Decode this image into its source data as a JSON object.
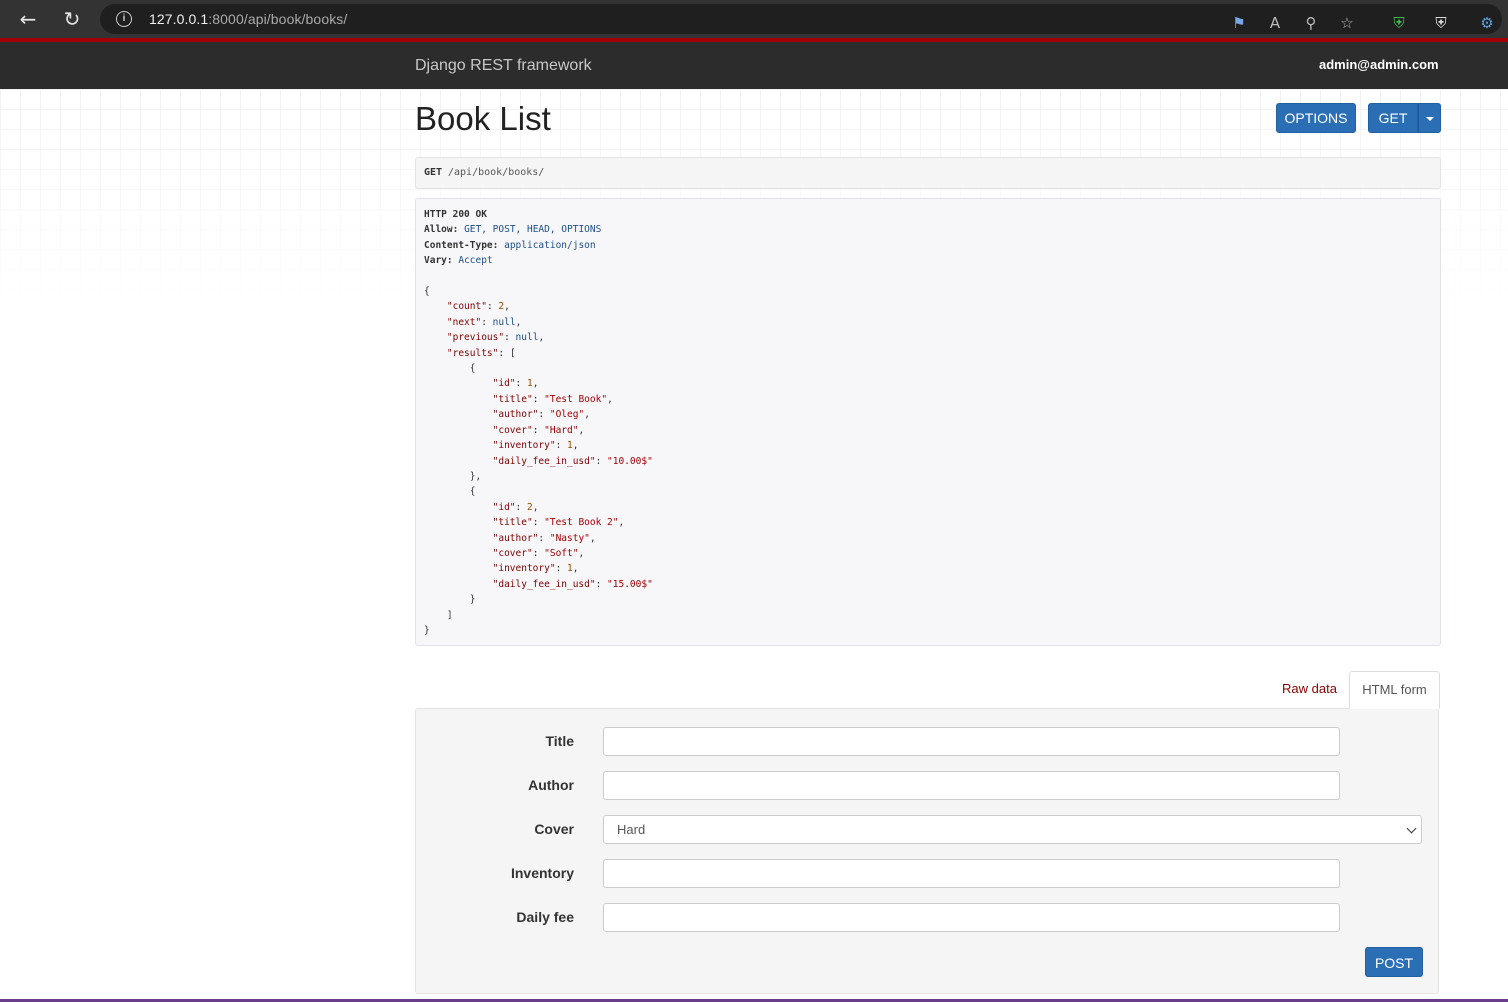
{
  "browser": {
    "url_host": "127.0.0.1",
    "url_rest": ":8000/api/book/books/"
  },
  "navbar": {
    "brand": "Django REST framework",
    "user": "admin@admin.com"
  },
  "page": {
    "title": "Book List",
    "options_label": "OPTIONS",
    "get_label": "GET"
  },
  "request": {
    "method": "GET",
    "path": "/api/book/books/"
  },
  "response": {
    "status": "HTTP 200 OK",
    "headers": [
      {
        "key": "Allow",
        "value": "GET, POST, HEAD, OPTIONS"
      },
      {
        "key": "Content-Type",
        "value": "application/json"
      },
      {
        "key": "Vary",
        "value": "Accept"
      }
    ],
    "body": {
      "count": "2",
      "next": "null",
      "previous": "null",
      "results": [
        {
          "id": "1",
          "title": "\"Test Book\"",
          "author": "\"Oleg\"",
          "cover": "\"Hard\"",
          "inventory": "1",
          "daily_fee_in_usd": "\"10.00$\""
        },
        {
          "id": "2",
          "title": "\"Test Book 2\"",
          "author": "\"Nasty\"",
          "cover": "\"Soft\"",
          "inventory": "1",
          "daily_fee_in_usd": "\"15.00$\""
        }
      ]
    }
  },
  "tabs": {
    "raw": "Raw data",
    "html": "HTML form"
  },
  "form": {
    "title_label": "Title",
    "author_label": "Author",
    "cover_label": "Cover",
    "cover_value": "Hard",
    "inventory_label": "Inventory",
    "daily_fee_label": "Daily fee",
    "post_label": "POST"
  }
}
